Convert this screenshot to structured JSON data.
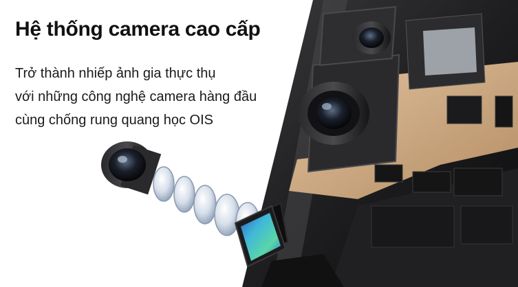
{
  "headline": "Hệ thống camera cao cấp",
  "subtext": {
    "line1": "Trở thành nhiếp ảnh gia thực thụ",
    "line2": "với những công nghệ camera hàng đầu",
    "line3": "cùng chống rung quang học OIS"
  },
  "colors": {
    "background": "#ffffff",
    "text": "#111111",
    "device_dark": "#1c1c1e",
    "copper_board": "#c8a47a",
    "sensor_cyan": "#3fb7d9"
  },
  "icons": [
    "camera-module-illustration",
    "lens-element-icon",
    "image-sensor-icon"
  ]
}
